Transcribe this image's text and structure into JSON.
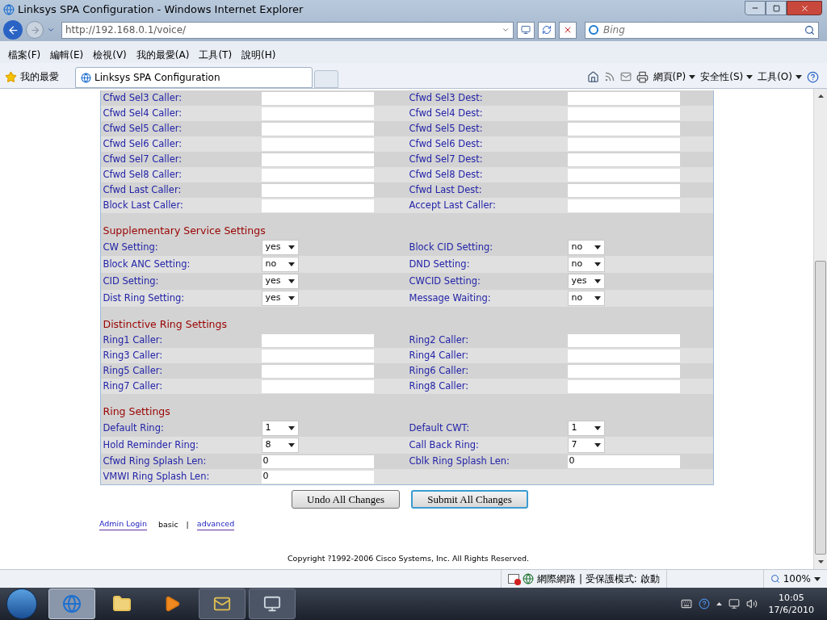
{
  "window": {
    "title": "Linksys SPA Configuration - Windows Internet Explorer"
  },
  "address_bar": {
    "url": "http://192.168.0.1/voice/"
  },
  "search": {
    "placeholder": "Bing"
  },
  "menu": [
    "檔案(F)",
    "編輯(E)",
    "檢視(V)",
    "我的最愛(A)",
    "工具(T)",
    "說明(H)"
  ],
  "favorites": {
    "label": "我的最愛"
  },
  "tabs": [
    {
      "label": "Linksys SPA Configuration",
      "selected": true
    }
  ],
  "command_bar": [
    {
      "label": "網頁(P)"
    },
    {
      "label": "安全性(S)"
    },
    {
      "label": "工具(O)"
    }
  ],
  "form": {
    "sections": [
      {
        "rows": [
          {
            "cells": [
              {
                "label": "Cfwd Sel3 Caller:",
                "field": {
                  "kind": "text"
                }
              },
              {
                "label": "Cfwd Sel3 Dest:",
                "field": {
                  "kind": "text"
                }
              }
            ]
          },
          {
            "cells": [
              {
                "label": "Cfwd Sel4 Caller:",
                "field": {
                  "kind": "text"
                }
              },
              {
                "label": "Cfwd Sel4 Dest:",
                "field": {
                  "kind": "text"
                }
              }
            ]
          },
          {
            "cells": [
              {
                "label": "Cfwd Sel5 Caller:",
                "field": {
                  "kind": "text"
                }
              },
              {
                "label": "Cfwd Sel5 Dest:",
                "field": {
                  "kind": "text"
                }
              }
            ]
          },
          {
            "cells": [
              {
                "label": "Cfwd Sel6 Caller:",
                "field": {
                  "kind": "text"
                }
              },
              {
                "label": "Cfwd Sel6 Dest:",
                "field": {
                  "kind": "text"
                }
              }
            ]
          },
          {
            "cells": [
              {
                "label": "Cfwd Sel7 Caller:",
                "field": {
                  "kind": "text"
                }
              },
              {
                "label": "Cfwd Sel7 Dest:",
                "field": {
                  "kind": "text"
                }
              }
            ]
          },
          {
            "cells": [
              {
                "label": "Cfwd Sel8 Caller:",
                "field": {
                  "kind": "text"
                }
              },
              {
                "label": "Cfwd Sel8 Dest:",
                "field": {
                  "kind": "text"
                }
              }
            ]
          },
          {
            "cells": [
              {
                "label": "Cfwd Last Caller:",
                "field": {
                  "kind": "text"
                }
              },
              {
                "label": "Cfwd Last Dest:",
                "field": {
                  "kind": "text"
                }
              }
            ]
          },
          {
            "cells": [
              {
                "label": "Block Last Caller:",
                "field": {
                  "kind": "text"
                }
              },
              {
                "label": "Accept Last Caller:",
                "field": {
                  "kind": "text"
                }
              }
            ]
          }
        ]
      },
      {
        "title": "Supplementary Service Settings",
        "rows": [
          {
            "cells": [
              {
                "label": "CW Setting:",
                "field": {
                  "kind": "select",
                  "value": "yes"
                }
              },
              {
                "label": "Block CID Setting:",
                "field": {
                  "kind": "select",
                  "value": "no"
                }
              }
            ]
          },
          {
            "cells": [
              {
                "label": "Block ANC Setting:",
                "field": {
                  "kind": "select",
                  "value": "no"
                }
              },
              {
                "label": "DND Setting:",
                "field": {
                  "kind": "select",
                  "value": "no"
                }
              }
            ]
          },
          {
            "cells": [
              {
                "label": "CID Setting:",
                "field": {
                  "kind": "select",
                  "value": "yes"
                }
              },
              {
                "label": "CWCID Setting:",
                "field": {
                  "kind": "select",
                  "value": "yes"
                }
              }
            ]
          },
          {
            "cells": [
              {
                "label": "Dist Ring Setting:",
                "field": {
                  "kind": "select",
                  "value": "yes"
                }
              },
              {
                "label": "Message Waiting:",
                "field": {
                  "kind": "select",
                  "value": "no"
                }
              }
            ]
          }
        ]
      },
      {
        "title": "Distinctive Ring Settings",
        "rows": [
          {
            "cells": [
              {
                "label": "Ring1 Caller:",
                "field": {
                  "kind": "text"
                }
              },
              {
                "label": "Ring2 Caller:",
                "field": {
                  "kind": "text"
                }
              }
            ]
          },
          {
            "cells": [
              {
                "label": "Ring3 Caller:",
                "field": {
                  "kind": "text"
                }
              },
              {
                "label": "Ring4 Caller:",
                "field": {
                  "kind": "text"
                }
              }
            ]
          },
          {
            "cells": [
              {
                "label": "Ring5 Caller:",
                "field": {
                  "kind": "text"
                }
              },
              {
                "label": "Ring6 Caller:",
                "field": {
                  "kind": "text"
                }
              }
            ]
          },
          {
            "cells": [
              {
                "label": "Ring7 Caller:",
                "field": {
                  "kind": "text"
                }
              },
              {
                "label": "Ring8 Caller:",
                "field": {
                  "kind": "text"
                }
              }
            ]
          }
        ]
      },
      {
        "title": "Ring Settings",
        "rows": [
          {
            "cells": [
              {
                "label": "Default Ring:",
                "field": {
                  "kind": "select",
                  "value": "1"
                }
              },
              {
                "label": "Default CWT:",
                "field": {
                  "kind": "select",
                  "value": "1"
                }
              }
            ]
          },
          {
            "cells": [
              {
                "label": "Hold Reminder Ring:",
                "field": {
                  "kind": "select",
                  "value": "8"
                }
              },
              {
                "label": "Call Back Ring:",
                "field": {
                  "kind": "select",
                  "value": "7"
                }
              }
            ]
          },
          {
            "cells": [
              {
                "label": "Cfwd Ring Splash Len:",
                "field": {
                  "kind": "text",
                  "value": "0"
                }
              },
              {
                "label": "Cblk Ring Splash Len:",
                "field": {
                  "kind": "text",
                  "value": "0"
                }
              }
            ]
          },
          {
            "cells": [
              {
                "label": "VMWI Ring Splash Len:",
                "field": {
                  "kind": "text",
                  "value": "0"
                }
              }
            ]
          }
        ]
      }
    ]
  },
  "buttons": [
    {
      "label": "Undo All Changes",
      "default": false
    },
    {
      "label": "Submit All Changes",
      "default": true
    }
  ],
  "links": [
    {
      "kind": "link",
      "text": "Admin Login"
    },
    {
      "kind": "text",
      "text": "basic"
    },
    {
      "kind": "separator",
      "text": "|"
    },
    {
      "kind": "link",
      "text": "advanced"
    }
  ],
  "copyright": "Copyright ?1992-2006 Cisco Systems, Inc. All Rights Reserved.",
  "status_bar": {
    "zone": "網際網路 | 受保護模式: 啟動",
    "zoom": "100%"
  },
  "taskbar": {
    "time": "10:05",
    "date": "17/6/2010"
  }
}
